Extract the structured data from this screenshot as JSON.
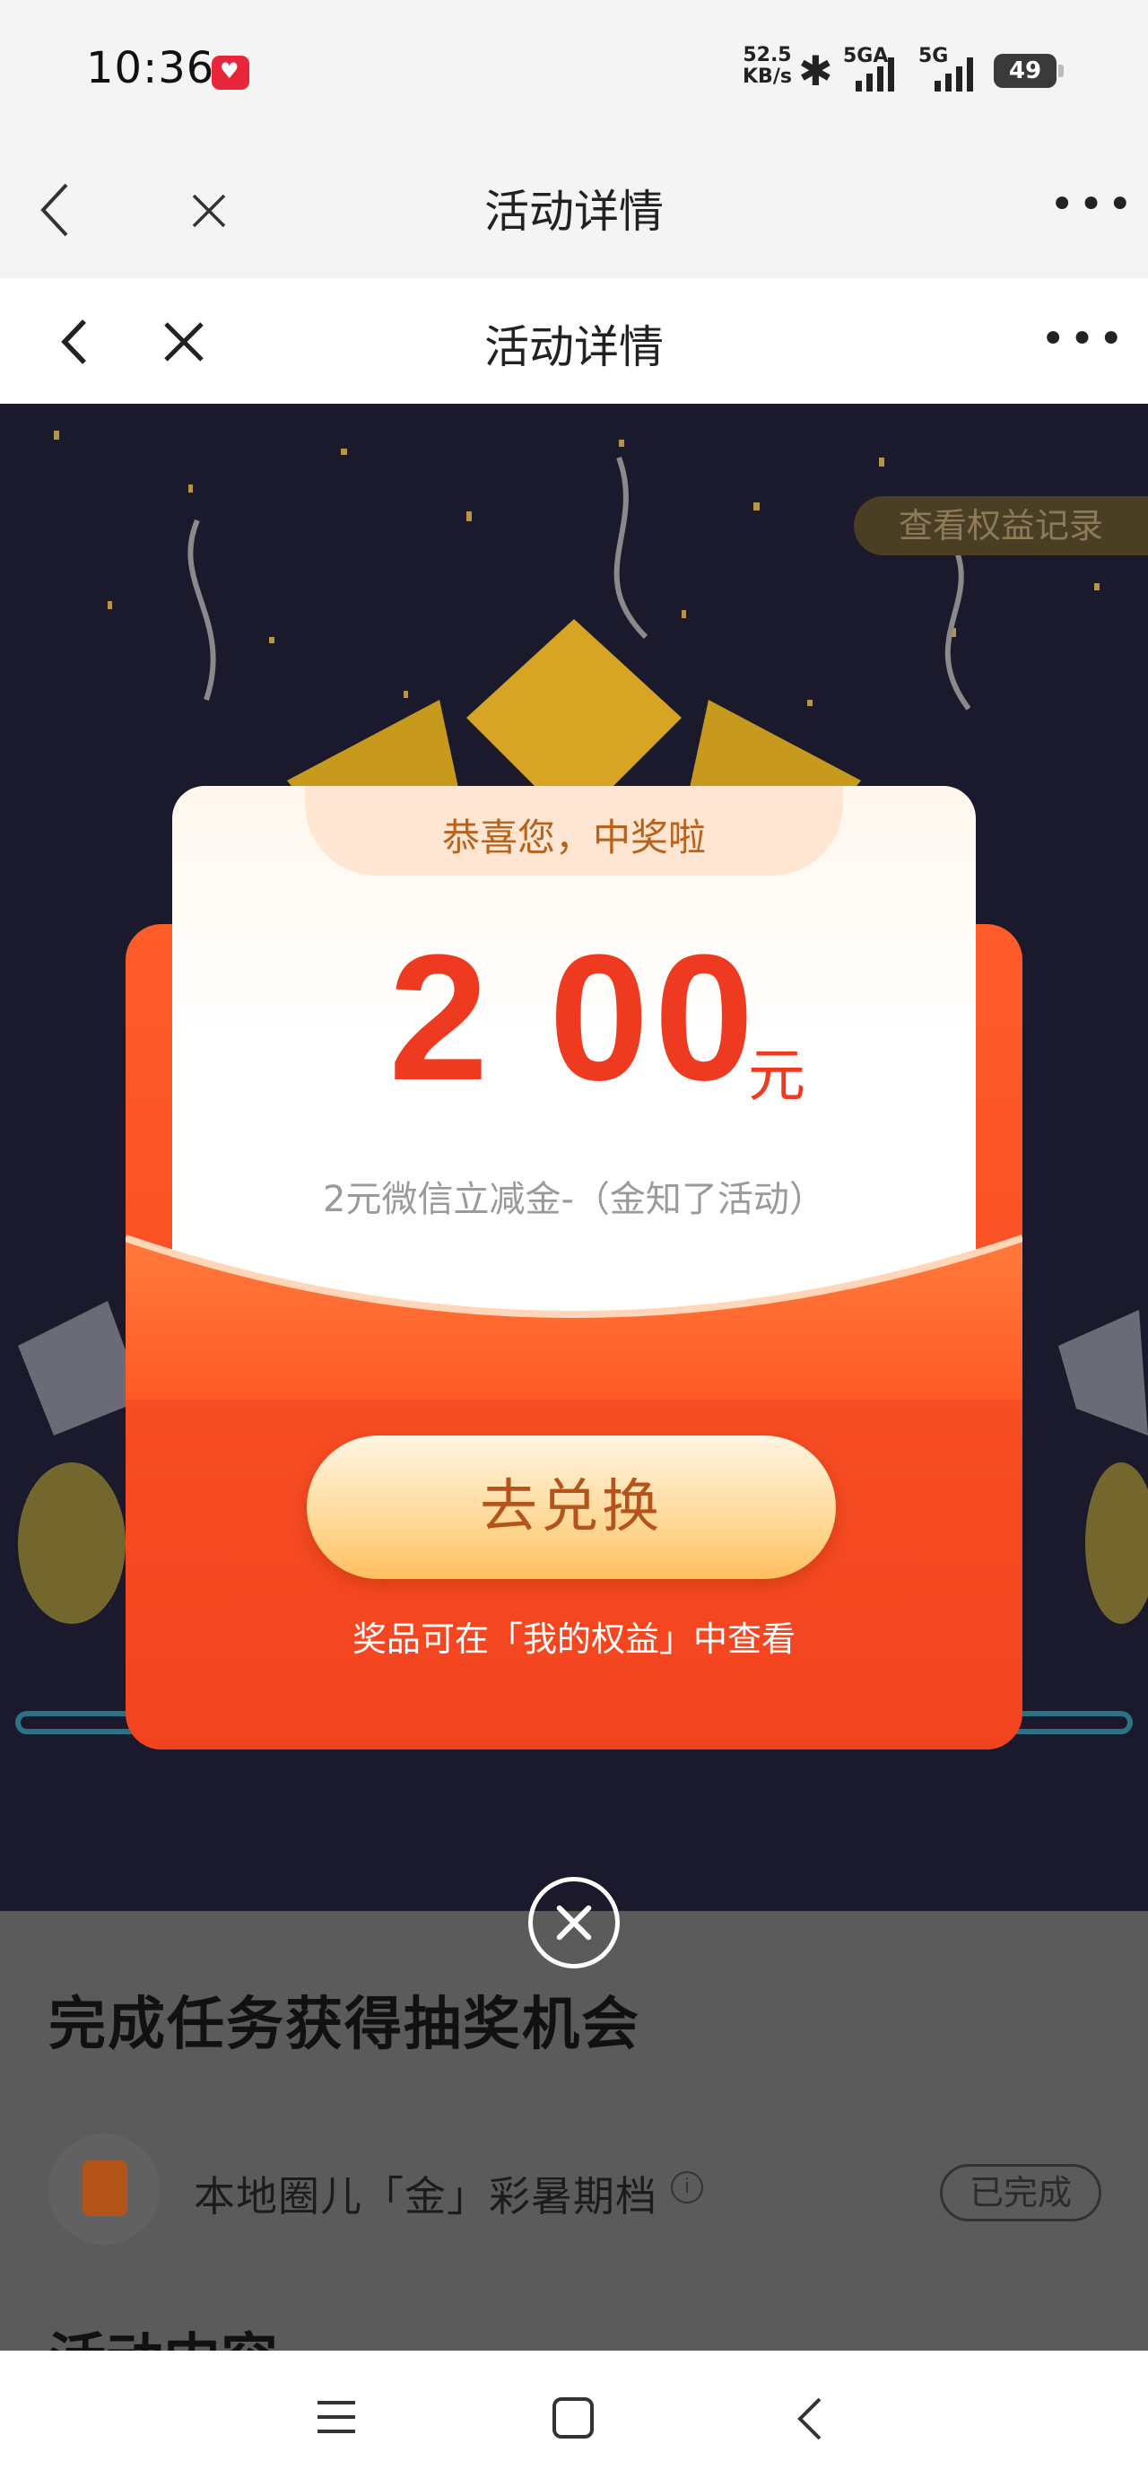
{
  "status_bar": {
    "time": "10:36",
    "net_speed": "52.5",
    "net_unit": "KB/s",
    "sim1": "5GA",
    "sim2": "5G",
    "battery": "49"
  },
  "header_outer": {
    "title": "活动详情"
  },
  "header_inner": {
    "title": "活动详情"
  },
  "top_link": "查看权益记录",
  "dialog": {
    "congrats": "恭喜您，中奖啦",
    "amount": "2 00",
    "unit": "元",
    "description": "2元微信立减金-（金知了活动）",
    "redeem_button": "去兑换",
    "hint": "奖品可在「我的权益」中查看"
  },
  "tasks": {
    "title": "完成任务获得抽奖机会",
    "items": [
      {
        "name": "本地圈儿「金」彩暑期档",
        "status": "已完成"
      }
    ]
  },
  "colors": {
    "accent_red": "#ee3a21",
    "envelope_orange": "#f75a25",
    "button_text": "#b5541a",
    "stage_bg": "#1b1a2c"
  }
}
